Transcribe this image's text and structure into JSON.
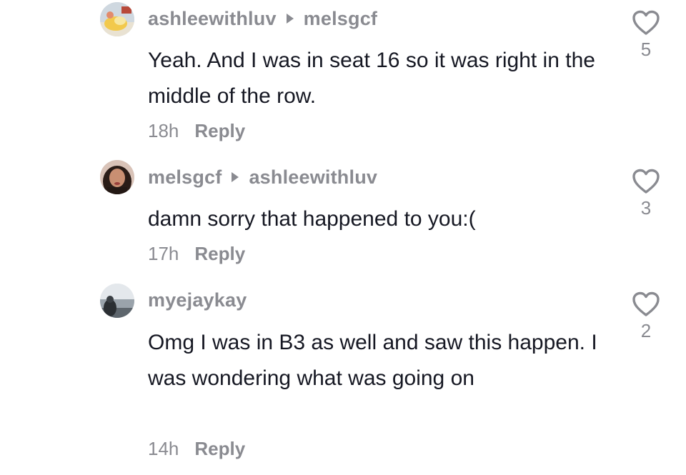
{
  "comments": [
    {
      "username": "ashleewithluv",
      "reply_to": "melsgcf",
      "text": "Yeah. And I was in seat 16 so it was right in the middle of the row.",
      "time": "18h",
      "reply_label": "Reply",
      "likes": "5",
      "avatar_icon": "beach-avatar"
    },
    {
      "username": "melsgcf",
      "reply_to": "ashleewithluv",
      "text": "damn sorry that happened to you:(",
      "time": "17h",
      "reply_label": "Reply",
      "likes": "3",
      "avatar_icon": "portrait-avatar"
    },
    {
      "username": "myejaykay",
      "text": "Omg I was in B3 as well and saw this happen. I was wondering what was going on",
      "time": "14h",
      "reply_label": "Reply",
      "likes": "2",
      "avatar_icon": "landscape-avatar"
    }
  ],
  "colors": {
    "primary_text": "#161823",
    "secondary_text": "#8a8b91"
  }
}
